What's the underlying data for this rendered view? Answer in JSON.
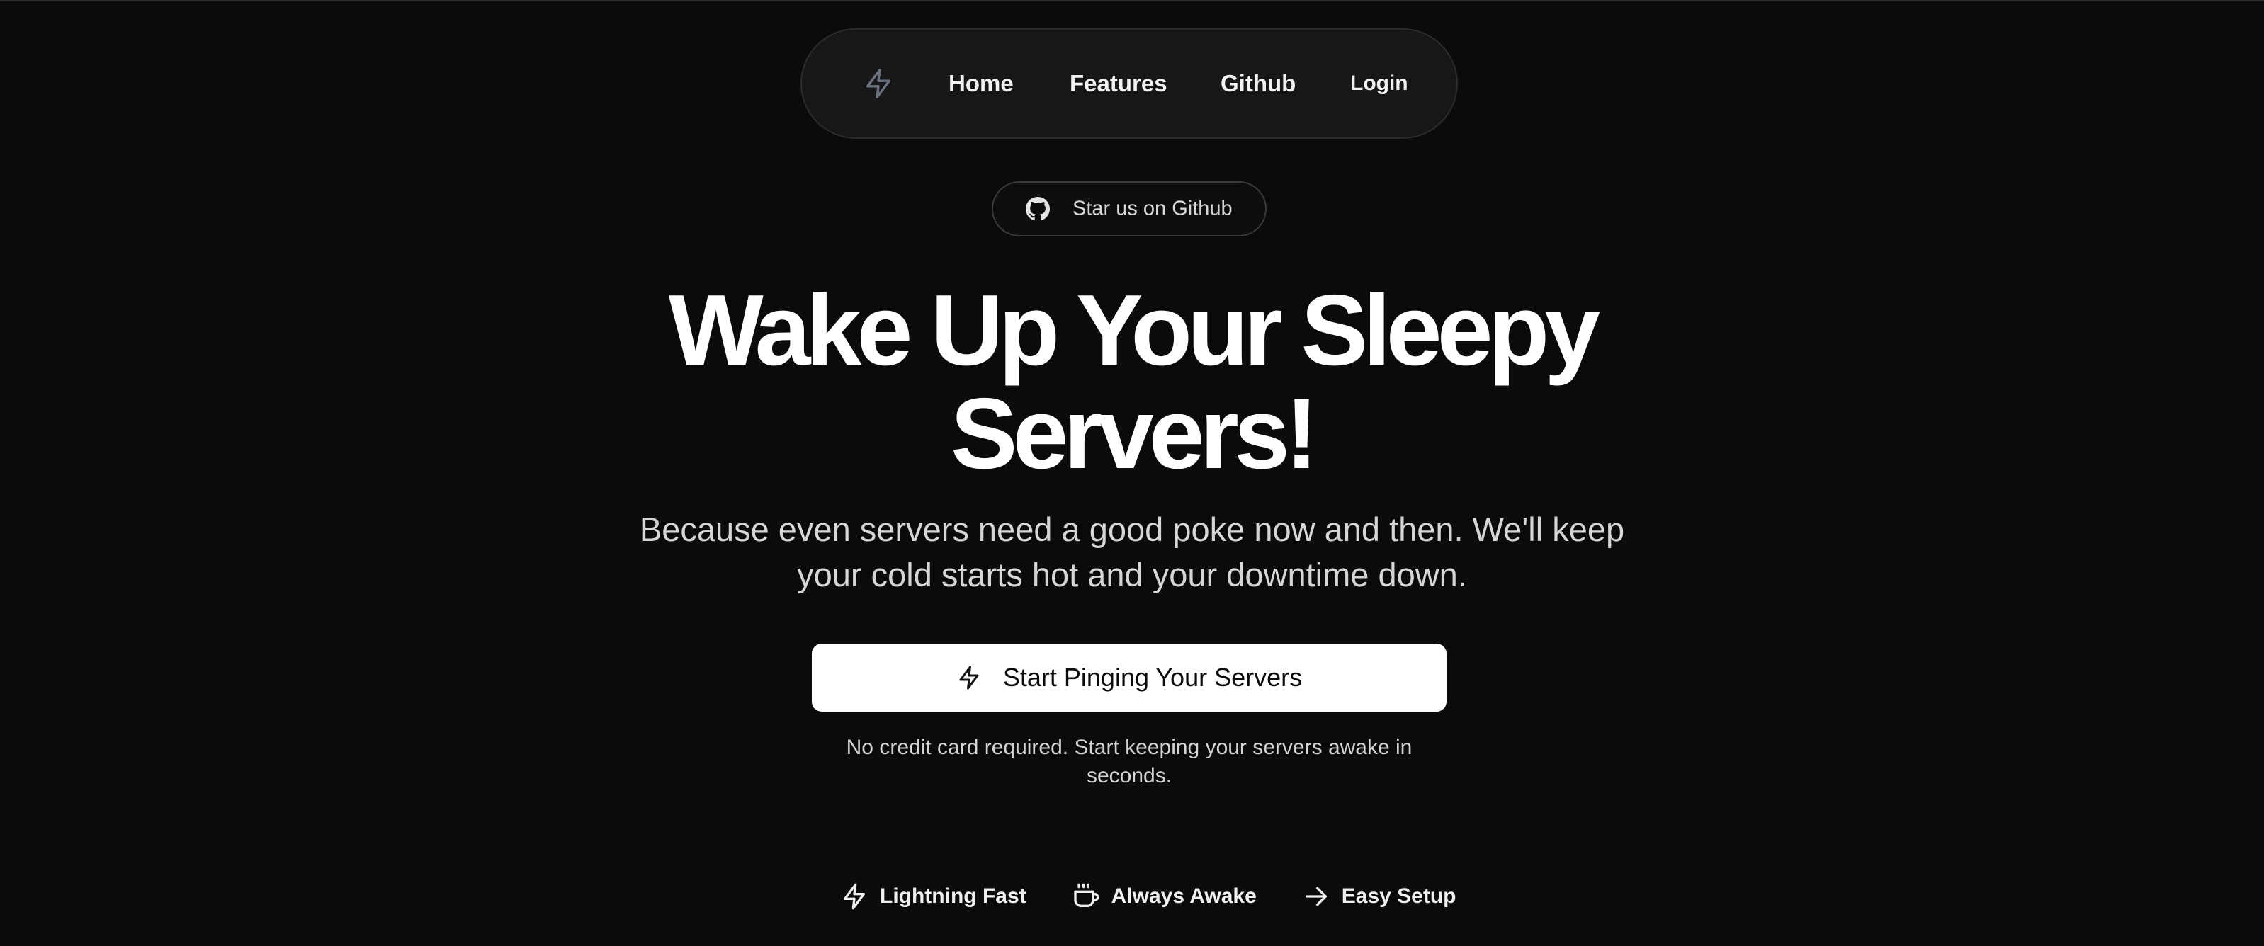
{
  "nav": {
    "logo_icon": "lightning-bolt-icon",
    "links": {
      "home": "Home",
      "features": "Features",
      "github": "Github",
      "login": "Login"
    }
  },
  "star_pill": {
    "icon": "github-icon",
    "label": "Star us on Github"
  },
  "hero": {
    "title_line1": "Wake Up Your Sleepy",
    "title_line2": "Servers!",
    "subtitle": "Because even servers need a good poke now and then. We'll keep your cold starts hot and your downtime down.",
    "cta": {
      "icon": "lightning-bolt-icon",
      "label": "Start Pinging Your Servers"
    },
    "note": "No credit card required. Start keeping your servers awake in seconds."
  },
  "features": [
    {
      "icon": "lightning-bolt-icon",
      "label": "Lightning Fast"
    },
    {
      "icon": "coffee-cup-icon",
      "label": "Always Awake"
    },
    {
      "icon": "arrow-right-icon",
      "label": "Easy Setup"
    }
  ],
  "colors": {
    "background": "#0b0b0b",
    "nav_background": "#171717",
    "cta_background": "#ffffff",
    "text": "#ffffff",
    "muted_text": "#d6d6d6"
  }
}
